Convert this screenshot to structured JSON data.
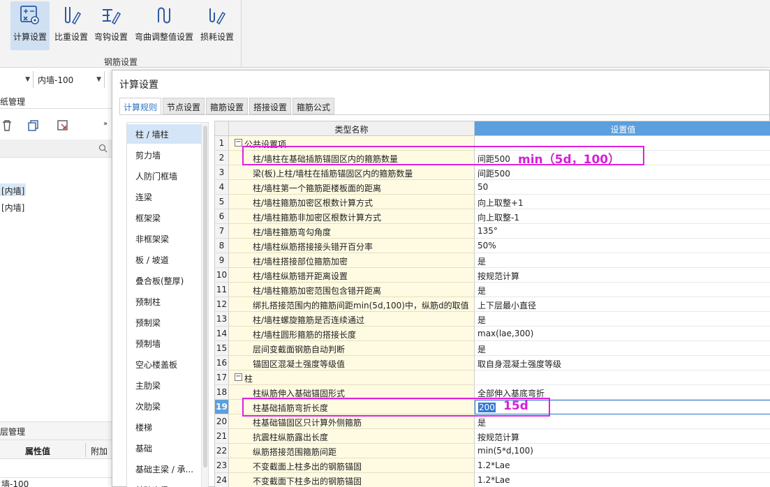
{
  "ribbon": {
    "buttons": [
      {
        "label": "计算设置",
        "icon": "calc-settings-icon"
      },
      {
        "label": "比重设置",
        "icon": "weight-settings-icon"
      },
      {
        "label": "弯钩设置",
        "icon": "hook-settings-icon"
      },
      {
        "label": "弯曲调整值设置",
        "icon": "bend-adjust-icon"
      },
      {
        "label": "损耗设置",
        "icon": "loss-settings-icon"
      }
    ],
    "group_label": "钢筋设置"
  },
  "left_panel": {
    "combo_value": "内墙-100",
    "section_title": "纸管理",
    "items": [
      "[内墙]",
      "[内墙]"
    ],
    "layer_title": "层管理",
    "col_attr": "属性值",
    "col_extra": "附加",
    "bottom_value": "墙-100"
  },
  "dialog": {
    "title": "计算设置",
    "tabs": [
      "计算规则",
      "节点设置",
      "箍筋设置",
      "搭接设置",
      "箍筋公式"
    ],
    "categories": [
      "柱 / 墙柱",
      "剪力墙",
      "人防门框墙",
      "连梁",
      "框架梁",
      "非框架梁",
      "板 / 坡道",
      "叠合板(整厚)",
      "预制柱",
      "预制梁",
      "预制墙",
      "空心楼盖板",
      "主肋梁",
      "次肋梁",
      "楼梯",
      "基础",
      "基础主梁 / 承...",
      "基础次梁"
    ],
    "grid": {
      "col_name": "类型名称",
      "col_value": "设置值",
      "rows": [
        {
          "num": "1",
          "name": "公共设置项",
          "value": "",
          "group": true
        },
        {
          "num": "2",
          "name": "柱/墙柱在基础插筋锚固区内的箍筋数量",
          "value": "间距500"
        },
        {
          "num": "3",
          "name": "梁(板)上柱/墙柱在插筋锚固区内的箍筋数量",
          "value": "间距500"
        },
        {
          "num": "4",
          "name": "柱/墙柱第一个箍筋距楼板面的距离",
          "value": "50"
        },
        {
          "num": "5",
          "name": "柱/墙柱箍筋加密区根数计算方式",
          "value": "向上取整+1"
        },
        {
          "num": "6",
          "name": "柱/墙柱箍筋非加密区根数计算方式",
          "value": "向上取整-1"
        },
        {
          "num": "7",
          "name": "柱/墙柱箍筋弯勾角度",
          "value": "135°"
        },
        {
          "num": "8",
          "name": "柱/墙柱纵筋搭接接头错开百分率",
          "value": "50%"
        },
        {
          "num": "9",
          "name": "柱/墙柱搭接部位箍筋加密",
          "value": "是"
        },
        {
          "num": "10",
          "name": "柱/墙柱纵筋错开距离设置",
          "value": "按规范计算"
        },
        {
          "num": "11",
          "name": "柱/墙柱箍筋加密范围包含错开距离",
          "value": "是"
        },
        {
          "num": "12",
          "name": "绑扎搭接范围内的箍筋间距min(5d,100)中，纵筋d的取值",
          "value": "上下层最小直径"
        },
        {
          "num": "13",
          "name": "柱/墙柱螺旋箍筋是否连续通过",
          "value": "是"
        },
        {
          "num": "14",
          "name": "柱/墙柱圆形箍筋的搭接长度",
          "value": "max(lae,300)"
        },
        {
          "num": "15",
          "name": "层间变截面钢筋自动判断",
          "value": "是"
        },
        {
          "num": "16",
          "name": "锚固区混凝土强度等级值",
          "value": "取自身混凝土强度等级"
        },
        {
          "num": "17",
          "name": "柱",
          "value": "",
          "group": true
        },
        {
          "num": "18",
          "name": "柱纵筋伸入基础锚固形式",
          "value": "全部伸入基底弯折"
        },
        {
          "num": "19",
          "name": "柱基础插筋弯折长度",
          "value": "200",
          "selected": true
        },
        {
          "num": "20",
          "name": "柱基础锚固区只计算外侧箍筋",
          "value": "是"
        },
        {
          "num": "21",
          "name": "抗震柱纵筋露出长度",
          "value": "按规范计算"
        },
        {
          "num": "22",
          "name": "纵筋搭接范围箍筋间距",
          "value": "min(5*d,100)"
        },
        {
          "num": "23",
          "name": "不变截面上柱多出的钢筋锚固",
          "value": "1.2*Lae"
        },
        {
          "num": "24",
          "name": "不变截面下柱多出的钢筋锚固",
          "value": "1.2*Lae"
        }
      ]
    }
  },
  "annotations": {
    "a1": "min（5d，100）",
    "a2": "15d"
  },
  "colors": {
    "accent": "#5b9fde",
    "annotation": "#e020e0",
    "name_bg": "#fffbe3"
  }
}
